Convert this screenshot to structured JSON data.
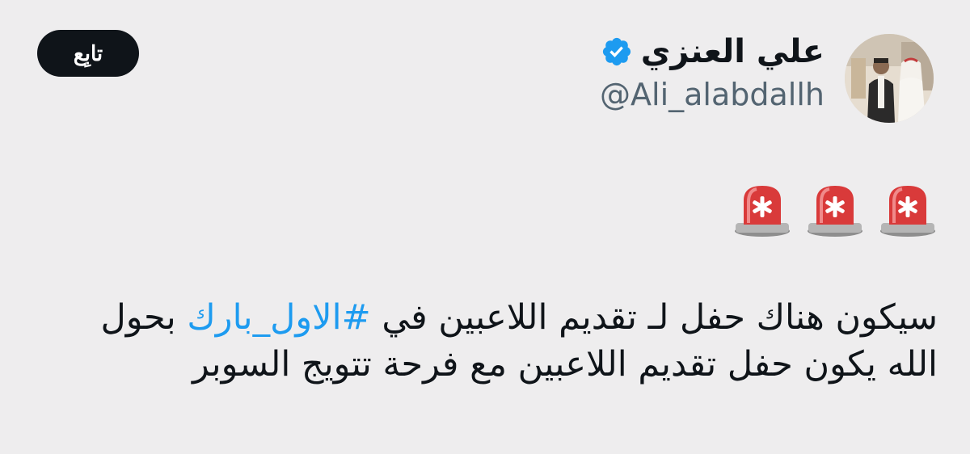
{
  "author": {
    "display_name": "علي العنزي",
    "handle": "@Ali_alabdallh",
    "verified": true
  },
  "follow_button": {
    "label": "تابِع"
  },
  "tweet": {
    "emojis": [
      "siren-icon",
      "siren-icon",
      "siren-icon"
    ],
    "line1_before": "سيكون هناك حفل لـ تقديم اللاعبين في ",
    "hashtag": "#الاول_بارك",
    "line1_after": " بحول",
    "line2": "الله يكون حفل تقديم اللاعبين مع فرحة تتويج السوبر"
  },
  "colors": {
    "background": "#eeedee",
    "hashtag": "#1d9bf0",
    "verified": "#1d9bf0",
    "follow_button_bg": "#0f1419",
    "handle": "#536471"
  }
}
